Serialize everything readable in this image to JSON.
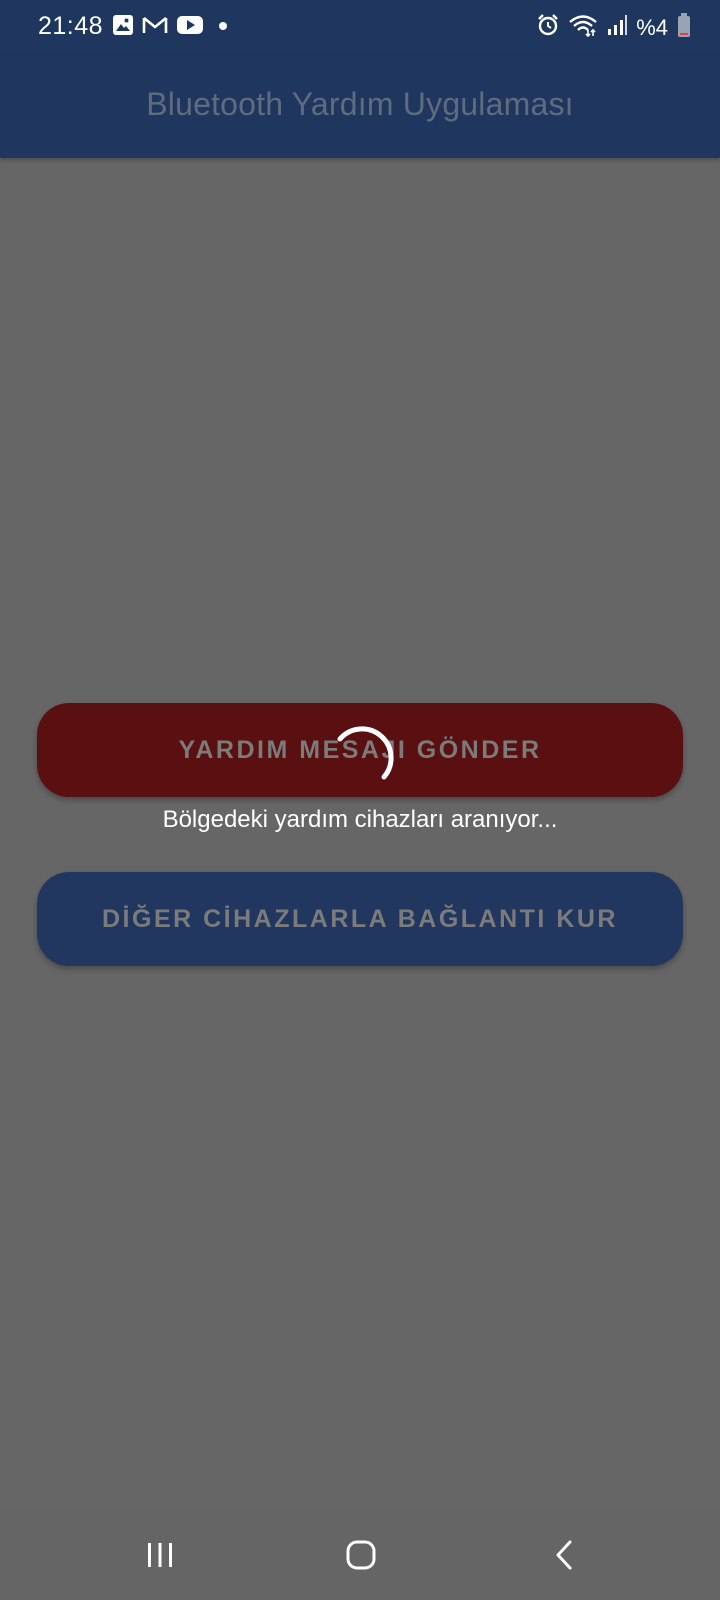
{
  "status_bar": {
    "time": "21:48",
    "battery_text": "%4",
    "notification_icons": [
      "gallery-icon",
      "gmail-icon",
      "youtube-icon",
      "dot-icon"
    ],
    "system_icons": [
      "alarm-icon",
      "wifi-icon",
      "signal-icon",
      "battery-icon"
    ]
  },
  "app_bar": {
    "title": "Bluetooth Yardım Uygulaması"
  },
  "main": {
    "help_button_label": "YARDIM MESAJI GÖNDER",
    "search_status": "Bölgedeki yardım cihazları aranıyor...",
    "connect_button_label": "DİĞER CİHAZLARLA BAĞLANTI KUR"
  },
  "nav_bar": {
    "buttons": [
      "recent-apps",
      "home",
      "back"
    ]
  },
  "colors": {
    "app_bar_bg": "#1f375f",
    "overlay_bg": "#666666",
    "help_button_bg": "#5a0f10",
    "connect_button_bg": "#22375f"
  }
}
